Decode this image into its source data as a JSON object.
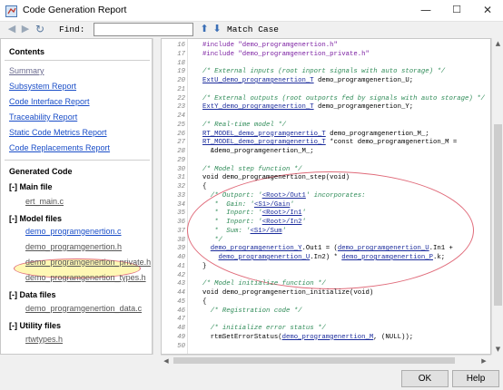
{
  "window": {
    "title": "Code Generation Report",
    "minimize_glyph": "—",
    "maximize_glyph": "☐",
    "close_glyph": "✕"
  },
  "toolbar": {
    "back_icon": "arrow-left-icon",
    "forward_icon": "arrow-right-icon",
    "refresh_icon": "refresh-icon",
    "find_label": "Find:",
    "find_value": "",
    "find_prev_icon": "arrow-up-icon",
    "find_next_icon": "arrow-down-icon",
    "match_case_label": "Match Case"
  },
  "sidebar": {
    "contents_title": "Contents",
    "links": [
      "Summary",
      "Subsystem Report",
      "Code Interface Report",
      "Traceability Report",
      "Static Code Metrics Report",
      "Code Replacements Report"
    ],
    "generated_code_title": "Generated Code",
    "groups": [
      {
        "toggle": "[-]",
        "title": "Main file",
        "files": [
          "ert_main.c"
        ]
      },
      {
        "toggle": "[-]",
        "title": "Model files",
        "files": [
          "demo_programgenertion.c",
          "demo_programgenertion.h",
          "demo_programgenertion_private.h",
          "demo_programgenertion_types.h"
        ]
      },
      {
        "toggle": "[-]",
        "title": "Data files",
        "files": [
          "demo_programgenertion_data.c"
        ]
      },
      {
        "toggle": "[-]",
        "title": "Utility files",
        "files": [
          "rtwtypes.h"
        ]
      }
    ],
    "active_file": "demo_programgenertion.c"
  },
  "code": {
    "lines": [
      {
        "n": "16",
        "parts": [
          [
            "pp",
            "#include \"demo_programgenertion.h\""
          ]
        ]
      },
      {
        "n": "17",
        "parts": [
          [
            "pp",
            "#include \"demo_programgenertion_private.h\""
          ]
        ]
      },
      {
        "n": "18",
        "parts": []
      },
      {
        "n": "19",
        "parts": [
          [
            "cm",
            "/* External inputs (root inport signals with auto storage) */"
          ]
        ]
      },
      {
        "n": "20",
        "parts": [
          [
            "cl",
            "ExtU_demo_programgenertion_T"
          ],
          [
            "k",
            " demo_programgenertion_U;"
          ]
        ]
      },
      {
        "n": "21",
        "parts": []
      },
      {
        "n": "22",
        "parts": [
          [
            "cm",
            "/* External outputs (root outports fed by signals with auto storage) */"
          ]
        ]
      },
      {
        "n": "23",
        "parts": [
          [
            "cl",
            "ExtY_demo_programgenertion_T"
          ],
          [
            "k",
            " demo_programgenertion_Y;"
          ]
        ]
      },
      {
        "n": "24",
        "parts": []
      },
      {
        "n": "25",
        "parts": [
          [
            "cm",
            "/* Real-time model */"
          ]
        ]
      },
      {
        "n": "26",
        "parts": [
          [
            "cl",
            "RT_MODEL_demo_programgenertio_T"
          ],
          [
            "k",
            " demo_programgenertion_M_;"
          ]
        ]
      },
      {
        "n": "27",
        "parts": [
          [
            "cl",
            "RT_MODEL_demo_programgenertio_T"
          ],
          [
            "k",
            " *const demo_programgenertion_M ="
          ]
        ]
      },
      {
        "n": "28",
        "parts": [
          [
            "k",
            "  &demo_programgenertion_M_;"
          ]
        ]
      },
      {
        "n": "29",
        "parts": []
      },
      {
        "n": "30",
        "parts": [
          [
            "cm",
            "/* Model step function */"
          ]
        ]
      },
      {
        "n": "31",
        "parts": [
          [
            "k",
            "void demo_programgenertion_step(void)"
          ]
        ]
      },
      {
        "n": "32",
        "parts": [
          [
            "k",
            "{"
          ]
        ]
      },
      {
        "n": "33",
        "parts": [
          [
            "cm",
            "  /* Outport: '"
          ],
          [
            "ln",
            "<Root>/Out1"
          ],
          [
            "cm",
            "' incorporates:"
          ]
        ]
      },
      {
        "n": "34",
        "parts": [
          [
            "cm",
            "   *  Gain: '"
          ],
          [
            "ln",
            "<S1>/Gain"
          ],
          [
            "cm",
            "'"
          ]
        ]
      },
      {
        "n": "35",
        "parts": [
          [
            "cm",
            "   *  Inport: '"
          ],
          [
            "ln",
            "<Root>/In1"
          ],
          [
            "cm",
            "'"
          ]
        ]
      },
      {
        "n": "36",
        "parts": [
          [
            "cm",
            "   *  Inport: '"
          ],
          [
            "ln",
            "<Root>/In2"
          ],
          [
            "cm",
            "'"
          ]
        ]
      },
      {
        "n": "37",
        "parts": [
          [
            "cm",
            "   *  Sum: '"
          ],
          [
            "ln",
            "<S1>/Sum"
          ],
          [
            "cm",
            "'"
          ]
        ]
      },
      {
        "n": "38",
        "parts": [
          [
            "cm",
            "   */"
          ]
        ]
      },
      {
        "n": "39",
        "parts": [
          [
            "k",
            "  "
          ],
          [
            "cl",
            "demo_programgenertion_Y"
          ],
          [
            "k",
            ".Out1 = ("
          ],
          [
            "cl",
            "demo_programgenertion_U"
          ],
          [
            "k",
            ".In1 +"
          ]
        ]
      },
      {
        "n": "40",
        "parts": [
          [
            "k",
            "    "
          ],
          [
            "cl",
            "demo_programgenertion_U"
          ],
          [
            "k",
            ".In2) * "
          ],
          [
            "cl",
            "demo_programgenertion_P"
          ],
          [
            "k",
            ".k;"
          ]
        ]
      },
      {
        "n": "41",
        "parts": [
          [
            "k",
            "}"
          ]
        ]
      },
      {
        "n": "42",
        "parts": []
      },
      {
        "n": "43",
        "parts": [
          [
            "cm",
            "/* Model initialize function */"
          ]
        ]
      },
      {
        "n": "44",
        "parts": [
          [
            "k",
            "void demo_programgenertion_initialize(void)"
          ]
        ]
      },
      {
        "n": "45",
        "parts": [
          [
            "k",
            "{"
          ]
        ]
      },
      {
        "n": "46",
        "parts": [
          [
            "cm",
            "  /* Registration code */"
          ]
        ]
      },
      {
        "n": "47",
        "parts": []
      },
      {
        "n": "48",
        "parts": [
          [
            "cm",
            "  /* initialize error status */"
          ]
        ]
      },
      {
        "n": "49",
        "parts": [
          [
            "k",
            "  rtmSetErrorStatus("
          ],
          [
            "cl",
            "demo_programgenertion_M"
          ],
          [
            "k",
            ", (NULL));"
          ]
        ]
      },
      {
        "n": "50",
        "parts": []
      }
    ]
  },
  "buttons": {
    "ok": "OK",
    "help": "Help"
  },
  "colors": {
    "link": "#1a4ec8",
    "comment": "#2e8b57",
    "preprocessor": "#7b1fa2",
    "highlight": "#fff278",
    "annotation": "#e06b7a"
  }
}
